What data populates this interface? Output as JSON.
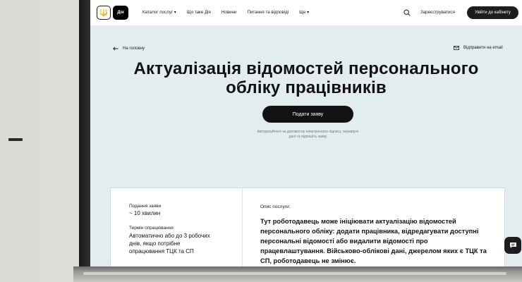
{
  "header": {
    "logo_trident": "🔱",
    "logo_diia": "Дія",
    "nav": [
      {
        "label": "Каталог послуг ▾"
      },
      {
        "label": "Що таке Дія"
      },
      {
        "label": "Новини"
      },
      {
        "label": "Питання та відповіді"
      },
      {
        "label": "Ще ▾"
      }
    ],
    "register_label": "Зареєструватися",
    "login_label": "Увійти до кабінету"
  },
  "subnav": {
    "back_label": "На головну",
    "email_label": "Відправити на email"
  },
  "main": {
    "title": "Актуалізація відомостей персонального обліку працівників",
    "cta_label": "Подати заяву",
    "hint": "Авторизуйтеся за допомогою електронного підпису, перевірте дані та підпишіть заяву"
  },
  "info": {
    "apply_label": "Подання заяви",
    "apply_value": "~ 10 хвилин",
    "term_label": "Термін опрацювання",
    "term_value": "Автоматично або до 3 робочих днів, якщо потрібне опрацювання ТЦК та СП",
    "desc_label": "Опис послуги:",
    "desc_text": "Тут роботодавець може ініціювати актуалізацію відомостей персонального обліку: додати працівника, відредагувати доступні персональні відомості або видалити відомості про працевлаштування. Військово-облікові дані, джерелом яких є ТЦК та СП, роботодавець не змінює."
  },
  "colors": {
    "accent": "#121212",
    "page_bg": "#e3ecef",
    "card_border": "#c8dde2"
  },
  "icons": [
    "search-icon",
    "arrow-left-icon",
    "mail-icon",
    "chat-icon",
    "trident-icon"
  ]
}
